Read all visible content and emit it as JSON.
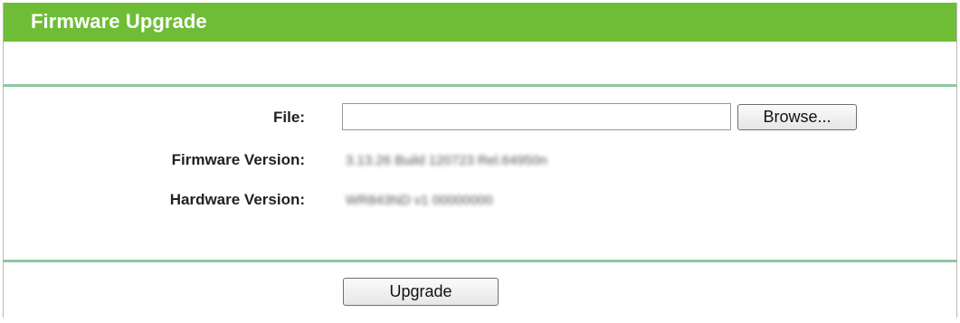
{
  "header": {
    "title": "Firmware Upgrade"
  },
  "form": {
    "file_label": "File:",
    "file_value": "",
    "browse_label": "Browse...",
    "firmware_label": "Firmware Version:",
    "firmware_value": "3.13.26 Build 120723 Rel.64950n",
    "hardware_label": "Hardware Version:",
    "hardware_value": "WR843ND v1 00000000"
  },
  "actions": {
    "upgrade_label": "Upgrade"
  },
  "colors": {
    "header_bg": "#6fbd36",
    "divider": "#8cc8a0"
  }
}
